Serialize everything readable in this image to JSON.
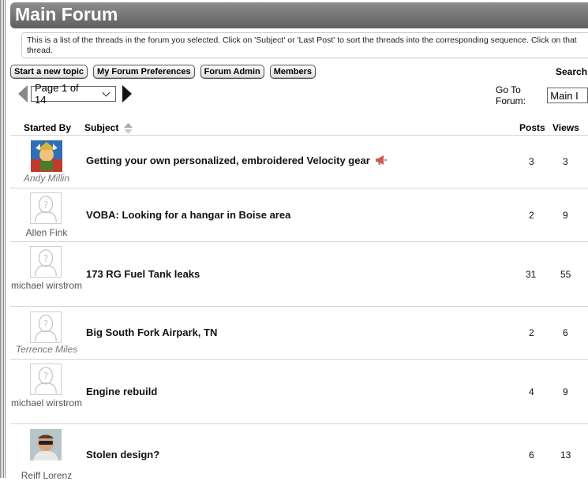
{
  "forum": {
    "title": "Main Forum",
    "description": "This is a list of the threads in the forum you selected. Click on 'Subject' or 'Last Post' to sort the threads into the corresponding sequence. Click on that thread."
  },
  "toolbar": {
    "new_topic": "Start a new topic",
    "preferences": "My Forum Preferences",
    "admin": "Forum Admin",
    "members": "Members",
    "search": "Search"
  },
  "pager": {
    "page_select": "Page 1 of 14",
    "goto_label": "Go To Forum:",
    "goto_value": "Main I"
  },
  "columns": {
    "started_by": "Started By",
    "subject": "Subject",
    "posts": "Posts",
    "views": "Views"
  },
  "threads": [
    {
      "author": "Andy Millin",
      "subject": "Getting your own personalized, embroidered Velocity gear",
      "posts": "3",
      "views": "3"
    },
    {
      "author": "Allen Fink",
      "subject": "VOBA: Looking for a hangar in Boise area",
      "posts": "2",
      "views": "9"
    },
    {
      "author": "michael wirstrom",
      "subject": "173 RG Fuel Tank leaks",
      "posts": "31",
      "views": "55"
    },
    {
      "author": "Terrence Miles",
      "subject": "Big South Fork Airpark, TN",
      "posts": "2",
      "views": "6"
    },
    {
      "author": "michael wirstrom",
      "subject": "Engine rebuild",
      "posts": "4",
      "views": "9"
    },
    {
      "author": "Reiff Lorenz",
      "subject": "Stolen design?",
      "posts": "6",
      "views": "13"
    }
  ]
}
